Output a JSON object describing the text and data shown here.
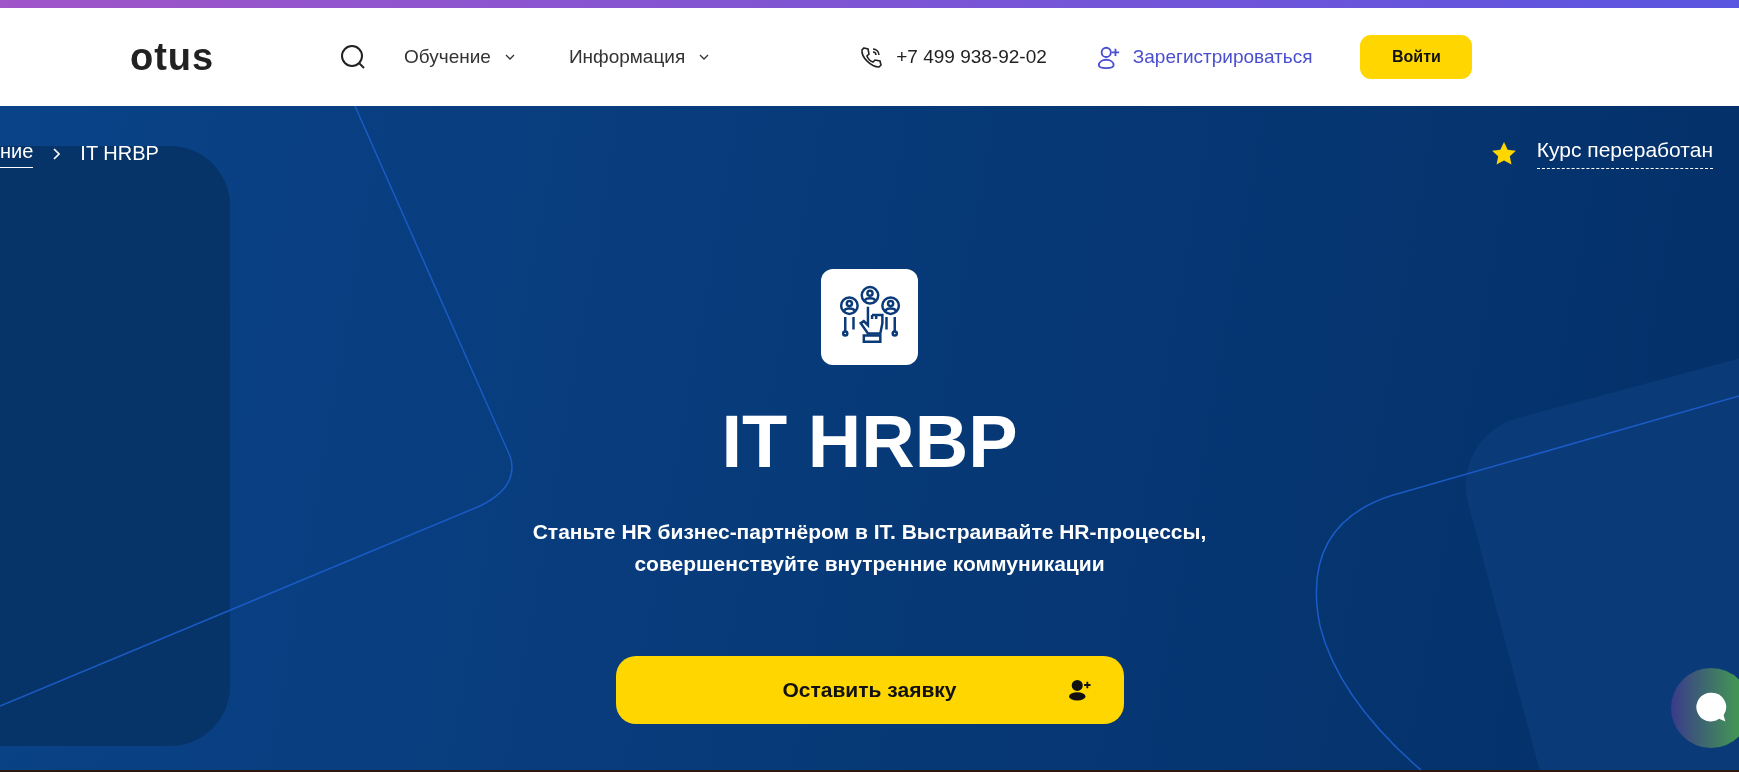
{
  "header": {
    "logo": "otus",
    "nav": [
      {
        "label": "Обучение"
      },
      {
        "label": "Информация"
      }
    ],
    "phone": "+7 499 938-92-02",
    "register": "Зарегистрироваться",
    "login": "Войти"
  },
  "breadcrumbs": [
    {
      "label": "ние",
      "link": true
    },
    {
      "label": "IT HRBP",
      "link": false
    }
  ],
  "badge": "Курс переработан",
  "hero": {
    "title": "IT HRBP",
    "subtitle_lines": [
      "Станьте HR бизнес-партнёром в IT. Выстраивайте HR-процессы,",
      "совершенствуйте внутренние коммуникации"
    ],
    "cta": "Оставить заявку"
  }
}
